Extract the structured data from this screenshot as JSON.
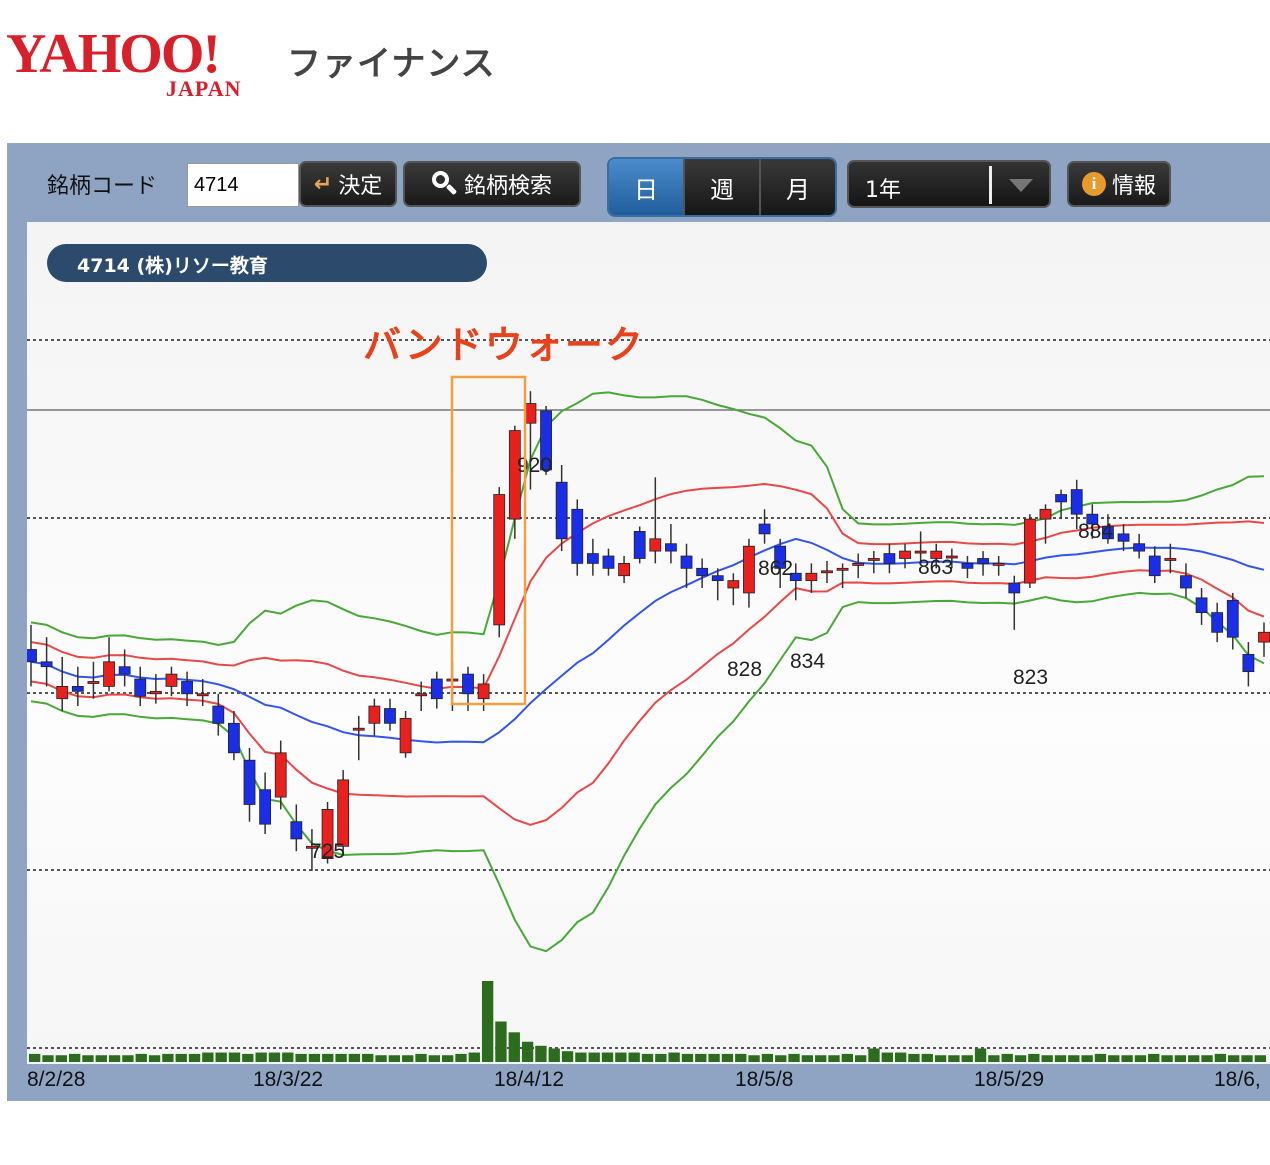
{
  "brand": {
    "logo_text": "YAHOO!",
    "logo_sub": "JAPAN",
    "service": "ファイナンス",
    "logo_color": "#d7202a"
  },
  "toolbar": {
    "code_label": "銘柄コード",
    "code_value": "4714",
    "decide_label": "決定",
    "search_label": "銘柄検索",
    "periods": [
      "日",
      "週",
      "月"
    ],
    "active_period": "日",
    "range_value": "1年",
    "info_label": "情報"
  },
  "chart": {
    "stock_name": "4714 (株)リソー教育",
    "annotation": "バンドウォーク",
    "annotation_color": "#e8421c",
    "highlight_color": "#f0a040"
  },
  "chart_data": {
    "type": "candlestick",
    "up_color": "#e8201e",
    "down_color": "#1a2ee8",
    "dates_shown": [
      "8/2/28",
      "18/3/22",
      "18/4/12",
      "18/5/8",
      "18/5/29",
      "18/6,"
    ],
    "price_labels": [
      "920",
      "862",
      "863",
      "884",
      "725",
      "828",
      "834",
      "823"
    ],
    "candles": [
      {
        "o": 815,
        "c": 810,
        "h": 825,
        "l": 800
      },
      {
        "o": 810,
        "c": 808,
        "h": 820,
        "l": 800
      },
      {
        "o": 795,
        "c": 800,
        "h": 812,
        "l": 790
      },
      {
        "o": 800,
        "c": 798,
        "h": 808,
        "l": 792
      },
      {
        "o": 802,
        "c": 802,
        "h": 810,
        "l": 795
      },
      {
        "o": 800,
        "c": 810,
        "h": 820,
        "l": 798
      },
      {
        "o": 808,
        "c": 805,
        "h": 815,
        "l": 800
      },
      {
        "o": 803,
        "c": 796,
        "h": 808,
        "l": 792
      },
      {
        "o": 797,
        "c": 798,
        "h": 805,
        "l": 793
      },
      {
        "o": 800,
        "c": 805,
        "h": 808,
        "l": 796
      },
      {
        "o": 802,
        "c": 797,
        "h": 806,
        "l": 792
      },
      {
        "o": 797,
        "c": 797,
        "h": 803,
        "l": 792
      },
      {
        "o": 792,
        "c": 785,
        "h": 797,
        "l": 780
      },
      {
        "o": 785,
        "c": 773,
        "h": 790,
        "l": 770
      },
      {
        "o": 770,
        "c": 752,
        "h": 775,
        "l": 745
      },
      {
        "o": 758,
        "c": 744,
        "h": 765,
        "l": 740
      },
      {
        "o": 755,
        "c": 773,
        "h": 778,
        "l": 750
      },
      {
        "o": 745,
        "c": 738,
        "h": 752,
        "l": 733
      },
      {
        "o": 735,
        "c": 735,
        "h": 742,
        "l": 725
      },
      {
        "o": 730,
        "c": 750,
        "h": 753,
        "l": 728
      },
      {
        "o": 735,
        "c": 762,
        "h": 766,
        "l": 733
      },
      {
        "o": 783,
        "c": 783,
        "h": 788,
        "l": 770
      },
      {
        "o": 785,
        "c": 792,
        "h": 795,
        "l": 780
      },
      {
        "o": 791,
        "c": 785,
        "h": 795,
        "l": 782
      },
      {
        "o": 773,
        "c": 787,
        "h": 790,
        "l": 771
      },
      {
        "o": 797,
        "c": 797,
        "h": 802,
        "l": 790
      },
      {
        "o": 803,
        "c": 795,
        "h": 806,
        "l": 791
      },
      {
        "o": 803,
        "c": 803,
        "h": 810,
        "l": 790
      },
      {
        "o": 805,
        "c": 797,
        "h": 808,
        "l": 790
      },
      {
        "o": 795,
        "c": 801,
        "h": 805,
        "l": 790
      },
      {
        "o": 825,
        "c": 878,
        "h": 881,
        "l": 820
      },
      {
        "o": 868,
        "c": 904,
        "h": 906,
        "l": 860
      },
      {
        "o": 907,
        "c": 915,
        "h": 920,
        "l": 880
      },
      {
        "o": 912,
        "c": 888,
        "h": 914,
        "l": 886
      },
      {
        "o": 883,
        "c": 860,
        "h": 890,
        "l": 855
      },
      {
        "o": 872,
        "c": 850,
        "h": 876,
        "l": 845
      },
      {
        "o": 854,
        "c": 850,
        "h": 860,
        "l": 845
      },
      {
        "o": 853,
        "c": 848,
        "h": 856,
        "l": 845
      },
      {
        "o": 845,
        "c": 850,
        "h": 853,
        "l": 842
      },
      {
        "o": 863,
        "c": 852,
        "h": 865,
        "l": 850
      },
      {
        "o": 855,
        "c": 860,
        "h": 885,
        "l": 850
      },
      {
        "o": 858,
        "c": 855,
        "h": 866,
        "l": 850
      },
      {
        "o": 853,
        "c": 848,
        "h": 858,
        "l": 840
      },
      {
        "o": 848,
        "c": 845,
        "h": 852,
        "l": 840
      },
      {
        "o": 845,
        "c": 843,
        "h": 848,
        "l": 835
      },
      {
        "o": 840,
        "c": 843,
        "h": 846,
        "l": 833
      },
      {
        "o": 838,
        "c": 857,
        "h": 860,
        "l": 832
      },
      {
        "o": 866,
        "c": 862,
        "h": 872,
        "l": 858
      },
      {
        "o": 857,
        "c": 848,
        "h": 860,
        "l": 840
      },
      {
        "o": 846,
        "c": 843,
        "h": 850,
        "l": 835
      },
      {
        "o": 843,
        "c": 846,
        "h": 850,
        "l": 838
      },
      {
        "o": 847,
        "c": 847,
        "h": 851,
        "l": 842
      },
      {
        "o": 848,
        "c": 848,
        "h": 850,
        "l": 840
      },
      {
        "o": 850,
        "c": 850,
        "h": 854,
        "l": 844
      },
      {
        "o": 852,
        "c": 852,
        "h": 855,
        "l": 846
      },
      {
        "o": 854,
        "c": 850,
        "h": 858,
        "l": 846
      },
      {
        "o": 852,
        "c": 855,
        "h": 858,
        "l": 848
      },
      {
        "o": 855,
        "c": 855,
        "h": 863,
        "l": 850
      },
      {
        "o": 852,
        "c": 855,
        "h": 858,
        "l": 848
      },
      {
        "o": 853,
        "c": 853,
        "h": 856,
        "l": 848
      },
      {
        "o": 850,
        "c": 848,
        "h": 853,
        "l": 844
      },
      {
        "o": 852,
        "c": 850,
        "h": 855,
        "l": 845
      },
      {
        "o": 850,
        "c": 850,
        "h": 853,
        "l": 845
      },
      {
        "o": 842,
        "c": 838,
        "h": 845,
        "l": 823
      },
      {
        "o": 842,
        "c": 868,
        "h": 870,
        "l": 840
      },
      {
        "o": 868,
        "c": 872,
        "h": 874,
        "l": 858
      },
      {
        "o": 878,
        "c": 875,
        "h": 880,
        "l": 868
      },
      {
        "o": 880,
        "c": 870,
        "h": 884,
        "l": 864
      },
      {
        "o": 870,
        "c": 866,
        "h": 874,
        "l": 860
      },
      {
        "o": 865,
        "c": 860,
        "h": 870,
        "l": 858
      },
      {
        "o": 862,
        "c": 859,
        "h": 866,
        "l": 855
      },
      {
        "o": 858,
        "c": 855,
        "h": 862,
        "l": 852
      },
      {
        "o": 853,
        "c": 845,
        "h": 857,
        "l": 842
      },
      {
        "o": 852,
        "c": 852,
        "h": 858,
        "l": 846
      },
      {
        "o": 845,
        "c": 840,
        "h": 850,
        "l": 836
      },
      {
        "o": 836,
        "c": 830,
        "h": 840,
        "l": 825
      },
      {
        "o": 830,
        "c": 822,
        "h": 834,
        "l": 818
      },
      {
        "o": 835,
        "c": 820,
        "h": 838,
        "l": 815
      },
      {
        "o": 813,
        "c": 806,
        "h": 818,
        "l": 800
      },
      {
        "o": 818,
        "c": 822,
        "h": 826,
        "l": 812
      }
    ],
    "volume": [
      6,
      5,
      5,
      6,
      5,
      5,
      5,
      5,
      6,
      5,
      6,
      6,
      6,
      7,
      7,
      7,
      6,
      7,
      7,
      7,
      6,
      6,
      6,
      6,
      6,
      6,
      5,
      5,
      5,
      6,
      5,
      5,
      6,
      7,
      60,
      30,
      22,
      15,
      12,
      10,
      8,
      7,
      7,
      7,
      7,
      7,
      6,
      6,
      7,
      6,
      6,
      6,
      6,
      6,
      5,
      6,
      5,
      6,
      5,
      5,
      5,
      6,
      5,
      10,
      7,
      7,
      6,
      6,
      5,
      5,
      5,
      10,
      5,
      6,
      5,
      6,
      5,
      5,
      5,
      5,
      6,
      5,
      5,
      5,
      6,
      5,
      5,
      5,
      5,
      6,
      5,
      5,
      5
    ]
  }
}
